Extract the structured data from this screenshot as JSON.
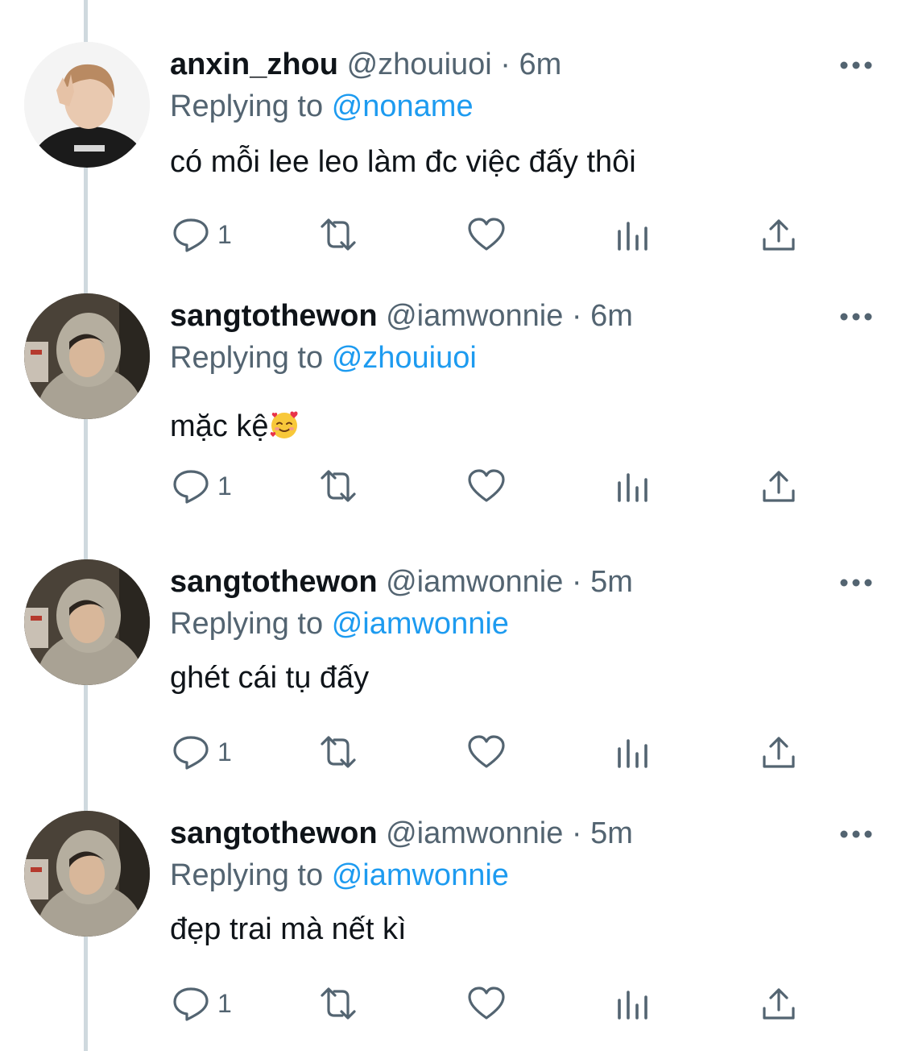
{
  "tweets": [
    {
      "name": "anxin_zhou",
      "handle": "@zhouiuoi",
      "separator": "·",
      "time": "6m",
      "replying_prefix": "Replying to",
      "replying_to": "@noname",
      "text": "có mỗi lee leo làm đc việc đấy thôi",
      "reply_count": "1",
      "avatar": "light-haired-person-peace-sign"
    },
    {
      "name": "sangtothewon",
      "handle": "@iamwonnie",
      "separator": "·",
      "time": "6m",
      "replying_prefix": "Replying to",
      "replying_to": "@zhouiuoi",
      "text": "mặc kệ",
      "emoji": "smiling-face-with-hearts",
      "reply_count": "1",
      "avatar": "person-in-grey-hoodie"
    },
    {
      "name": "sangtothewon",
      "handle": "@iamwonnie",
      "separator": "·",
      "time": "5m",
      "replying_prefix": "Replying to",
      "replying_to": "@iamwonnie",
      "text": "ghét cái tụ đấy",
      "reply_count": "1",
      "avatar": "person-in-grey-hoodie"
    },
    {
      "name": "sangtothewon",
      "handle": "@iamwonnie",
      "separator": "·",
      "time": "5m",
      "replying_prefix": "Replying to",
      "replying_to": "@iamwonnie",
      "text": "đẹp trai mà nết kì",
      "reply_count": "1",
      "avatar": "person-in-grey-hoodie"
    }
  ],
  "icons": {
    "reply": "reply-icon",
    "retweet": "retweet-icon",
    "like": "heart-icon",
    "views": "analytics-icon",
    "share": "share-icon",
    "more": "more-icon"
  },
  "colors": {
    "text": "#0f1419",
    "secondary": "#536471",
    "mention": "#1d9bf0",
    "thread_line": "#cfd9de"
  }
}
